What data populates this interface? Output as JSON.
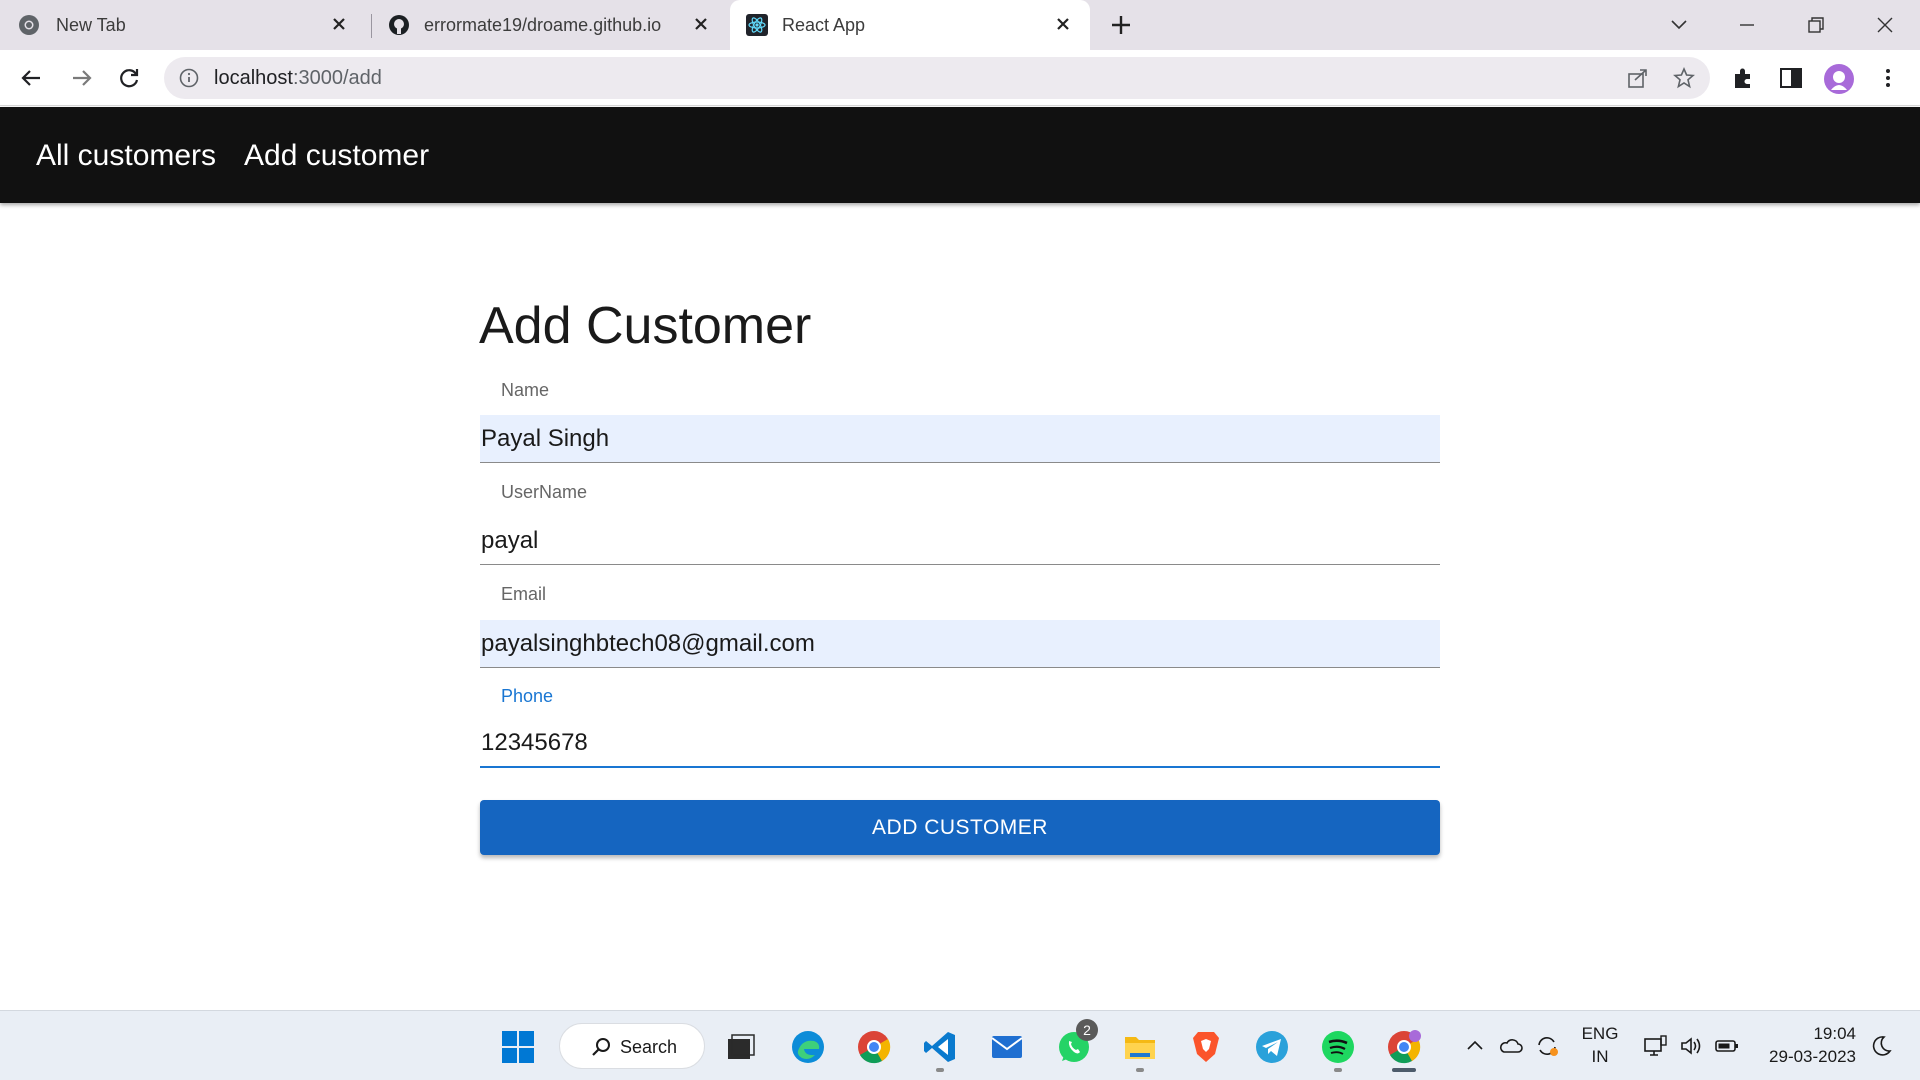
{
  "browser": {
    "tabs": [
      {
        "title": "New Tab",
        "icon": "chrome-icon"
      },
      {
        "title": "errormate19/droame.github.io",
        "icon": "github-icon"
      },
      {
        "title": "React App",
        "icon": "react-icon",
        "active": true
      }
    ],
    "url_host": "localhost",
    "url_path": ":3000/add"
  },
  "navbar": {
    "links": [
      "All customers",
      "Add customer"
    ]
  },
  "form": {
    "title": "Add Customer",
    "fields": [
      {
        "label": "Name",
        "value": "Payal Singh"
      },
      {
        "label": "UserName",
        "value": "payal"
      },
      {
        "label": "Email",
        "value": "payalsinghbtech08@gmail.com"
      },
      {
        "label": "Phone",
        "value": "12345678"
      }
    ],
    "submit_label": "ADD CUSTOMER"
  },
  "taskbar": {
    "search_label": "Search",
    "whatsapp_badge": "2",
    "language_line1": "ENG",
    "language_line2": "IN",
    "time": "19:04",
    "date": "29-03-2023"
  },
  "colors": {
    "appbar_bg": "#111111",
    "primary": "#1565c0",
    "focus": "#1976d2",
    "autofill": "#e8f0fe"
  }
}
